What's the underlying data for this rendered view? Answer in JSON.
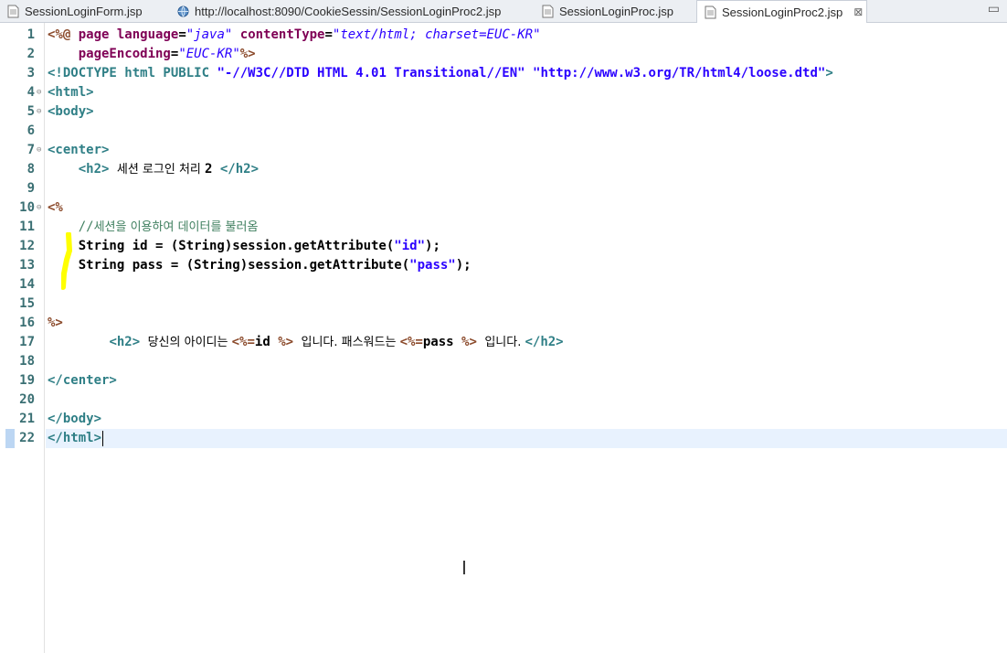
{
  "tabs": [
    {
      "label": "SessionLoginForm.jsp",
      "icon": "jsp-file-icon"
    },
    {
      "label": "http://localhost:8090/CookieSessin/SessionLoginProc2.jsp",
      "icon": "globe-icon"
    },
    {
      "label": "SessionLoginProc.jsp",
      "icon": "jsp-file-icon"
    },
    {
      "label": "SessionLoginProc2.jsp",
      "icon": "jsp-file-icon",
      "active": true,
      "close": "⊠"
    }
  ],
  "window_controls": "▭",
  "colors": {
    "highlight": "#ffff00",
    "current_line": "#e8f2fe"
  },
  "editor": {
    "current_line": 22,
    "lines": [
      {
        "num": "1",
        "fold": "",
        "segs": [
          [
            "jsp",
            "<%@ "
          ],
          [
            "attr",
            "page "
          ],
          [
            "attr",
            "language"
          ],
          [
            "plain",
            "="
          ],
          [
            "str",
            "\"java\""
          ],
          [
            "plain",
            " "
          ],
          [
            "attr",
            "contentType"
          ],
          [
            "plain",
            "="
          ],
          [
            "str",
            "\"text/html; charset=EUC-KR\""
          ]
        ]
      },
      {
        "num": "2",
        "fold": "",
        "segs": [
          [
            "plain",
            "    "
          ],
          [
            "attr",
            "pageEncoding"
          ],
          [
            "plain",
            "="
          ],
          [
            "str",
            "\"EUC-KR\""
          ],
          [
            "jsp",
            "%>"
          ]
        ]
      },
      {
        "num": "3",
        "fold": "",
        "segs": [
          [
            "tag",
            "<!DOCTYPE html PUBLIC "
          ],
          [
            "dstr",
            "\"-//W3C//DTD HTML 4.01 Transitional//EN\" \"http://www.w3.org/TR/html4/loose.dtd\""
          ],
          [
            "tag",
            ">"
          ]
        ]
      },
      {
        "num": "4",
        "fold": "⊖",
        "segs": [
          [
            "tag",
            "<html>"
          ]
        ]
      },
      {
        "num": "5",
        "fold": "⊖",
        "segs": [
          [
            "tag",
            "<body>"
          ]
        ]
      },
      {
        "num": "6",
        "fold": "",
        "segs": []
      },
      {
        "num": "7",
        "fold": "⊖",
        "segs": [
          [
            "tag",
            "<center>"
          ]
        ]
      },
      {
        "num": "8",
        "fold": "",
        "segs": [
          [
            "plain",
            "    "
          ],
          [
            "tag",
            "<h2>"
          ],
          [
            "plain",
            " "
          ],
          [
            "kor",
            "세션 로그인 처리 "
          ],
          [
            "plain",
            "2 "
          ],
          [
            "tag",
            "</h2>"
          ]
        ]
      },
      {
        "num": "9",
        "fold": "",
        "segs": []
      },
      {
        "num": "10",
        "fold": "⊖",
        "segs": [
          [
            "jsp",
            "<%"
          ]
        ]
      },
      {
        "num": "11",
        "fold": "",
        "segs": [
          [
            "plain",
            "    "
          ],
          [
            "cmt",
            "//"
          ],
          [
            "kork",
            "세션을 이용하여 데이터를 불러옴"
          ]
        ]
      },
      {
        "num": "12",
        "fold": "",
        "segs": [
          [
            "plain",
            "    String id = (String)session.getAttribute("
          ],
          [
            "dstr",
            "\"id\""
          ],
          [
            "plain",
            ");"
          ]
        ]
      },
      {
        "num": "13",
        "fold": "",
        "segs": [
          [
            "plain",
            "    String pass = (String)session.getAttribute("
          ],
          [
            "dstr",
            "\"pass\""
          ],
          [
            "plain",
            ");"
          ]
        ]
      },
      {
        "num": "14",
        "fold": "",
        "segs": []
      },
      {
        "num": "15",
        "fold": "",
        "segs": []
      },
      {
        "num": "16",
        "fold": "",
        "segs": [
          [
            "jsp",
            "%>"
          ]
        ]
      },
      {
        "num": "17",
        "fold": "",
        "segs": [
          [
            "plain",
            "        "
          ],
          [
            "tag",
            "<h2>"
          ],
          [
            "plain",
            " "
          ],
          [
            "kor",
            "당신의 아이디는 "
          ],
          [
            "jsp",
            "<%="
          ],
          [
            "plain",
            "id "
          ],
          [
            "jsp",
            "%>"
          ],
          [
            "plain",
            " "
          ],
          [
            "kor",
            "입니다. 패스워드는 "
          ],
          [
            "jsp",
            "<%="
          ],
          [
            "plain",
            "pass "
          ],
          [
            "jsp",
            "%>"
          ],
          [
            "plain",
            " "
          ],
          [
            "kor",
            "입니다. "
          ],
          [
            "tag",
            "</h2>"
          ]
        ]
      },
      {
        "num": "18",
        "fold": "",
        "segs": []
      },
      {
        "num": "19",
        "fold": "",
        "segs": [
          [
            "tag",
            "</center>"
          ]
        ]
      },
      {
        "num": "20",
        "fold": "",
        "segs": []
      },
      {
        "num": "21",
        "fold": "",
        "segs": [
          [
            "tag",
            "</body>"
          ]
        ]
      },
      {
        "num": "22",
        "fold": "",
        "segs": [
          [
            "tag",
            "</html>"
          ]
        ]
      }
    ]
  }
}
